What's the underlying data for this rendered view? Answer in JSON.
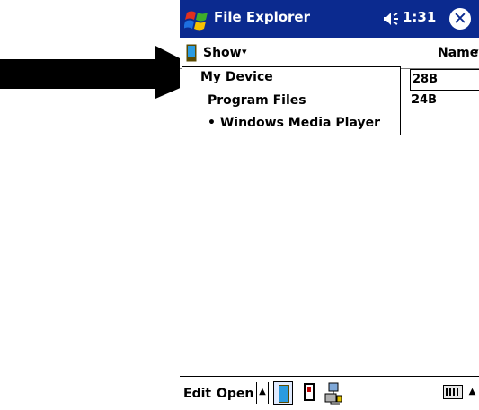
{
  "titlebar": {
    "app_title": "File Explorer",
    "time": "1:31",
    "close_glyph": "✕",
    "icons": [
      "windows-start-icon",
      "speaker-icon",
      "close-icon"
    ]
  },
  "toolbar": {
    "show_label": "Show",
    "sort_label": "Name",
    "caret": "▾"
  },
  "dropdown": {
    "items": [
      {
        "label": "My Device",
        "selected": false
      },
      {
        "label": "Program Files",
        "selected": false
      },
      {
        "label": "• Windows Media Player",
        "selected": true
      }
    ]
  },
  "file_sizes": [
    "28B",
    "24B"
  ],
  "bottombar": {
    "edit_label": "Edit",
    "open_label": "Open",
    "up_glyph": "▲",
    "icons": [
      "my-device-icon",
      "storage-card-icon",
      "network-icon",
      "keyboard-icon"
    ]
  },
  "colors": {
    "titlebar": "#0b2a8f",
    "background": "#ffffff",
    "arrow": "#000000"
  }
}
